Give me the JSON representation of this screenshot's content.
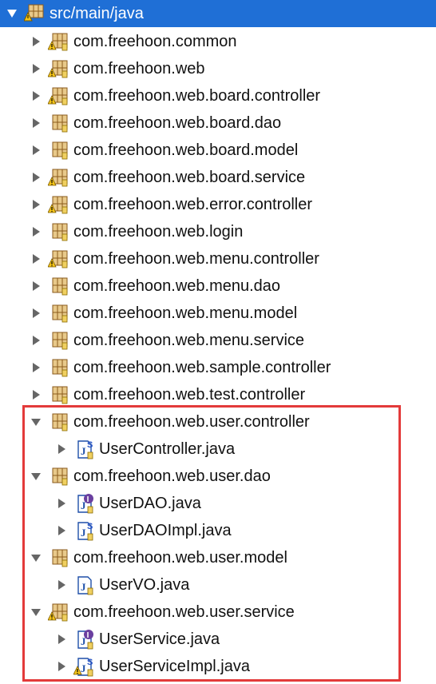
{
  "tree": {
    "root": {
      "label": "src/main/java",
      "expanded": true
    },
    "packages": [
      {
        "label": "com.freehoon.common",
        "expanded": false,
        "warning": true
      },
      {
        "label": "com.freehoon.web",
        "expanded": false,
        "warning": true
      },
      {
        "label": "com.freehoon.web.board.controller",
        "expanded": false,
        "warning": true
      },
      {
        "label": "com.freehoon.web.board.dao",
        "expanded": false,
        "warning": false
      },
      {
        "label": "com.freehoon.web.board.model",
        "expanded": false,
        "warning": false
      },
      {
        "label": "com.freehoon.web.board.service",
        "expanded": false,
        "warning": true
      },
      {
        "label": "com.freehoon.web.error.controller",
        "expanded": false,
        "warning": true
      },
      {
        "label": "com.freehoon.web.login",
        "expanded": false,
        "warning": false
      },
      {
        "label": "com.freehoon.web.menu.controller",
        "expanded": false,
        "warning": true
      },
      {
        "label": "com.freehoon.web.menu.dao",
        "expanded": false,
        "warning": false
      },
      {
        "label": "com.freehoon.web.menu.model",
        "expanded": false,
        "warning": false
      },
      {
        "label": "com.freehoon.web.menu.service",
        "expanded": false,
        "warning": false
      },
      {
        "label": "com.freehoon.web.sample.controller",
        "expanded": false,
        "warning": false
      },
      {
        "label": "com.freehoon.web.test.controller",
        "expanded": false,
        "warning": false
      },
      {
        "label": "com.freehoon.web.user.controller",
        "expanded": true,
        "warning": false,
        "files": [
          {
            "label": "UserController.java",
            "badge": "S",
            "warning": false
          }
        ]
      },
      {
        "label": "com.freehoon.web.user.dao",
        "expanded": true,
        "warning": false,
        "files": [
          {
            "label": "UserDAO.java",
            "badge": "I",
            "warning": false
          },
          {
            "label": "UserDAOImpl.java",
            "badge": "S",
            "warning": false
          }
        ]
      },
      {
        "label": "com.freehoon.web.user.model",
        "expanded": true,
        "warning": false,
        "files": [
          {
            "label": "UserVO.java",
            "badge": "",
            "warning": false
          }
        ]
      },
      {
        "label": "com.freehoon.web.user.service",
        "expanded": true,
        "warning": true,
        "files": [
          {
            "label": "UserService.java",
            "badge": "I",
            "warning": false
          },
          {
            "label": "UserServiceImpl.java",
            "badge": "S",
            "warning": true
          }
        ]
      }
    ]
  },
  "colors": {
    "selection": "#1f6fd6",
    "highlight_border": "#e33a3a",
    "package_brown": "#a8752e",
    "package_light": "#e8c98a",
    "warning_yellow": "#f5c518",
    "badge_purple": "#6a3fa0",
    "badge_blue": "#2a56c6"
  }
}
